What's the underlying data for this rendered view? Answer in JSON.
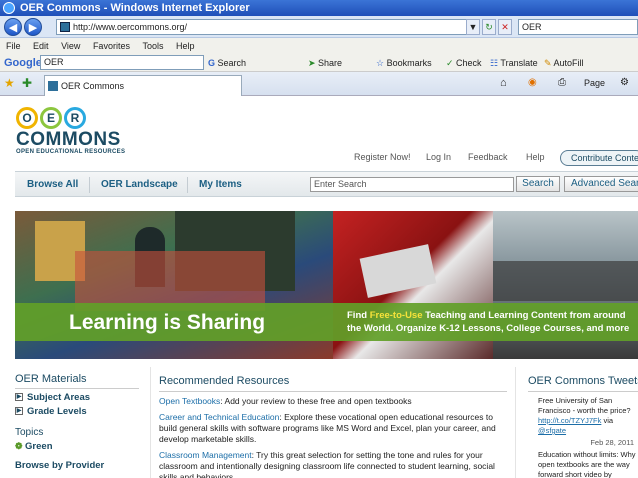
{
  "browser": {
    "window_title": "OER Commons - Windows Internet Explorer",
    "address": "http://www.oercommons.org/",
    "search_box": "OER",
    "menu": [
      "File",
      "Edit",
      "View",
      "Favorites",
      "Tools",
      "Help"
    ],
    "google_bar": {
      "logo": "Google",
      "query": "OER",
      "tools": [
        "Search",
        "Share",
        "Bookmarks",
        "Check",
        "Translate",
        "AutoFill"
      ]
    },
    "tab_title": "OER Commons",
    "toolbar_right": [
      "Page"
    ]
  },
  "site": {
    "logo_letters": [
      "O",
      "E",
      "R"
    ],
    "logo_word": "COMMONS",
    "logo_sub": "OPEN EDUCATIONAL RESOURCES",
    "top_links": [
      "Register Now!",
      "Log In",
      "Feedback",
      "Help"
    ],
    "contribute": "Contribute Content",
    "nav": [
      "Browse All",
      "OER Landscape",
      "My Items"
    ],
    "search_placeholder": "Enter Search",
    "search_button": "Search",
    "advanced_button": "Advanced Search",
    "banner": {
      "headline": "Learning is Sharing",
      "find_prefix": "Find",
      "find_highlight": "Free-to-Use",
      "find_rest": "Teaching and Learning Content from around",
      "find_line2": "the World. Organize K-12 Lessons, College Courses, and more"
    },
    "left": {
      "heading": "OER Materials",
      "items": [
        "Subject Areas",
        "Grade Levels"
      ],
      "topics_heading": "Topics",
      "topics": [
        "Green"
      ],
      "provider": "Browse by Provider"
    },
    "recommended": {
      "heading": "Recommended Resources",
      "items": [
        {
          "title": "Open Textbooks",
          "text": ": Add your review to these free and open textbooks"
        },
        {
          "title": "Career and Technical Education",
          "text": ": Explore these vocational open educational resources to build general skills with software programs like MS Word and Excel, plan your career, and develop marketable skills."
        },
        {
          "title": "Classroom Management",
          "text": ": Try this great selection for setting the tone and rules for your classroom and intentionally designing classroom life connected to student learning, social skills and behaviors."
        }
      ]
    },
    "tweets": {
      "heading": "OER Commons Tweets",
      "items": [
        {
          "text": "Free University of San Francisco - worth the price?",
          "link": "http://t.co/TZYJ7Fk",
          "via": " via ",
          "user": "@sfgate",
          "date": "Feb 28, 2011"
        },
        {
          "text": "Education without limits: Why open textbooks are the way forward short video by"
        }
      ]
    }
  }
}
